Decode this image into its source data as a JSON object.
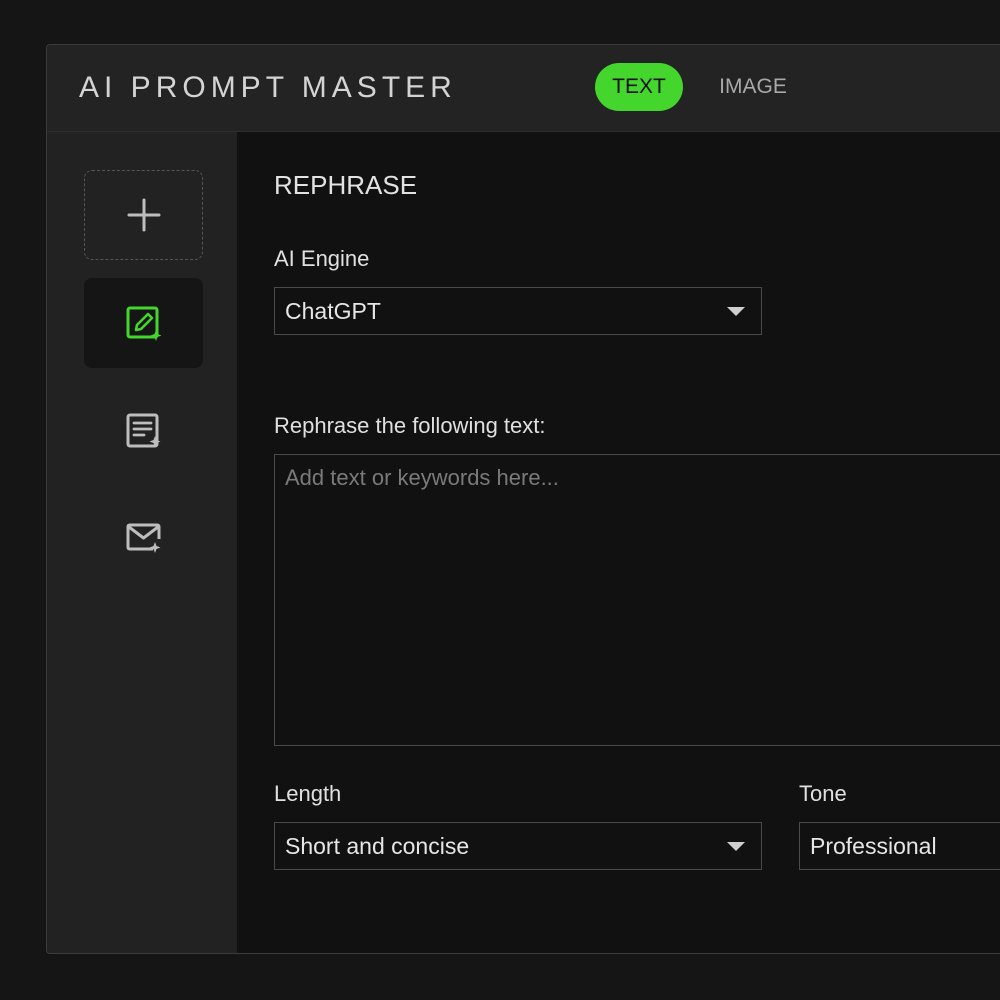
{
  "app": {
    "title": "AI PROMPT MASTER"
  },
  "tabs": [
    {
      "label": "TEXT",
      "active": true
    },
    {
      "label": "IMAGE",
      "active": false
    }
  ],
  "sidebar": {
    "items": [
      {
        "icon": "plus-icon"
      },
      {
        "icon": "edit-sparkle-icon",
        "active": true
      },
      {
        "icon": "document-sparkle-icon"
      },
      {
        "icon": "mail-sparkle-icon"
      }
    ]
  },
  "main": {
    "section_title": "REPHRASE",
    "engine": {
      "label": "AI Engine",
      "value": "ChatGPT"
    },
    "input": {
      "label": "Rephrase the following text:",
      "placeholder": "Add text or keywords here..."
    },
    "length": {
      "label": "Length",
      "value": "Short and concise"
    },
    "tone": {
      "label": "Tone",
      "value": "Professional"
    }
  },
  "colors": {
    "accent": "#44d62c",
    "background": "#111111",
    "sidebar": "#222222",
    "titlebar": "#232323"
  }
}
